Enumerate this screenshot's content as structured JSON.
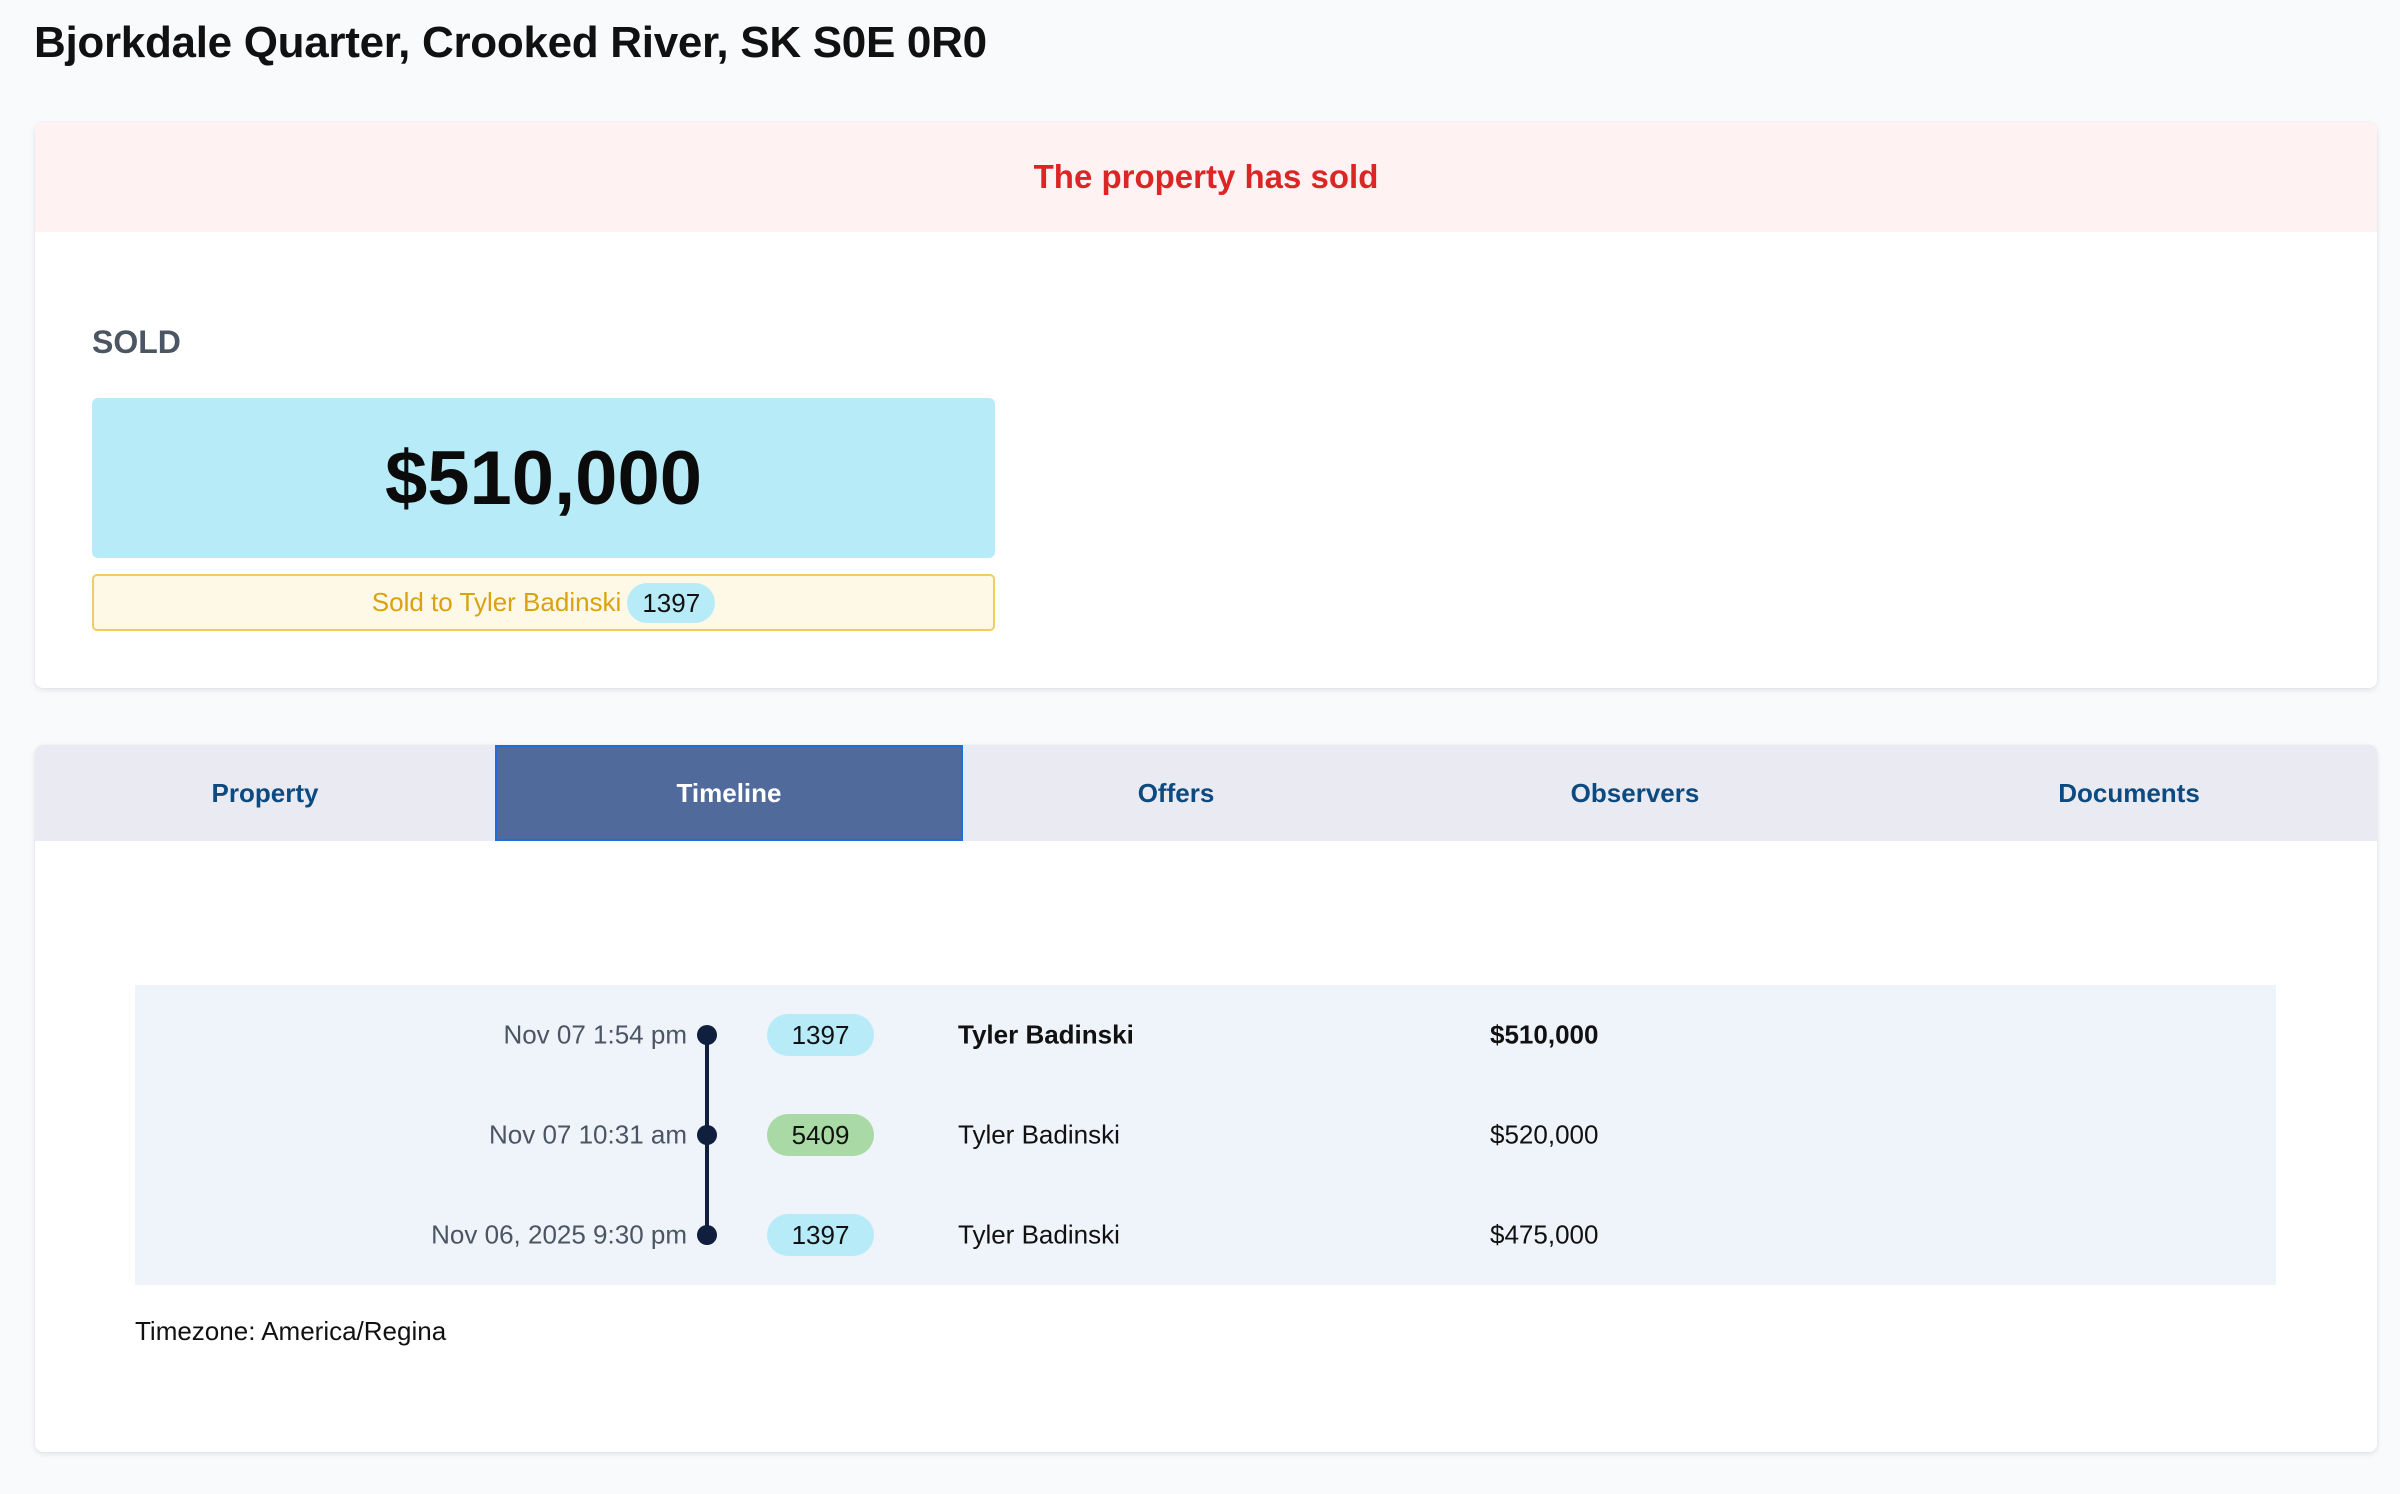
{
  "page": {
    "title": "Bjorkdale Quarter, Crooked River, SK S0E 0R0"
  },
  "status": {
    "banner": "The property has sold",
    "label": "SOLD",
    "price": "$510,000",
    "sold_to_text": "Sold to Tyler Badinski",
    "sold_to_bidder": "1397"
  },
  "tabs": [
    {
      "label": "Property",
      "active": false
    },
    {
      "label": "Timeline",
      "active": true
    },
    {
      "label": "Offers",
      "active": false
    },
    {
      "label": "Observers",
      "active": false
    },
    {
      "label": "Documents",
      "active": false
    }
  ],
  "timeline": {
    "rows": [
      {
        "time": "Nov 07 1:54 pm",
        "bidder": "1397",
        "bidder_color": "#b8ebf8",
        "name": "Tyler Badinski",
        "amount": "$510,000"
      },
      {
        "time": "Nov 07 10:31 am",
        "bidder": "5409",
        "bidder_color": "#a9d9a4",
        "name": "Tyler Badinski",
        "amount": "$520,000"
      },
      {
        "time": "Nov 06, 2025 9:30 pm",
        "bidder": "1397",
        "bidder_color": "#b8ebf8",
        "name": "Tyler Badinski",
        "amount": "$475,000"
      }
    ],
    "timezone": "Timezone: America/Regina"
  },
  "colors": {
    "alert_text": "#dc2626",
    "alert_bg": "#fef2f2",
    "price_bg": "#b8ebf8",
    "active_tab_bg": "#506a9b",
    "tab_text": "#0c4a80"
  }
}
